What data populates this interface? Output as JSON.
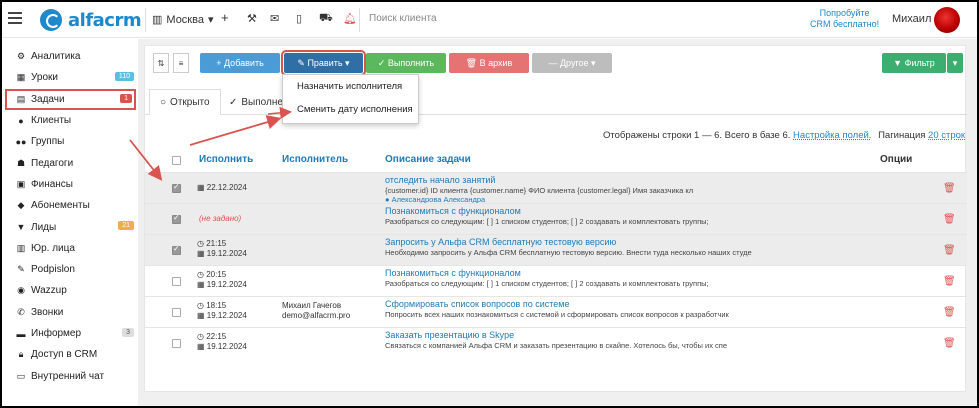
{
  "topbar": {
    "logo_text": "alfacrm",
    "city": "Москва",
    "search_placeholder": "Поиск клиента",
    "promo_line1": "Попробуйте",
    "promo_line2": "CRM бесплатно!",
    "user_name": "Михаил"
  },
  "sidebar": {
    "items": [
      {
        "label": "Аналитика",
        "icon": "chart-icon",
        "glyph": "⚙"
      },
      {
        "label": "Уроки",
        "icon": "calendar-icon",
        "glyph": "▦",
        "badge": "110",
        "badge_color": "#5bc0de"
      },
      {
        "label": "Задачи",
        "icon": "tasks-icon",
        "glyph": "▤",
        "badge": "1",
        "badge_color": "#d9534f",
        "active": true
      },
      {
        "label": "Клиенты",
        "icon": "user-icon",
        "glyph": "●"
      },
      {
        "label": "Группы",
        "icon": "group-icon",
        "glyph": "●●"
      },
      {
        "label": "Педагоги",
        "icon": "teacher-icon",
        "glyph": "☗"
      },
      {
        "label": "Финансы",
        "icon": "money-icon",
        "glyph": "▣"
      },
      {
        "label": "Абонементы",
        "icon": "tag-icon",
        "glyph": "◆"
      },
      {
        "label": "Лиды",
        "icon": "funnel-icon",
        "glyph": "▼",
        "badge": "21",
        "badge_color": "#f0ad4e"
      },
      {
        "label": "Юр. лица",
        "icon": "building-icon",
        "glyph": "▥"
      },
      {
        "label": "Podpislon",
        "icon": "sign-icon",
        "glyph": "✎"
      },
      {
        "label": "Wazzup",
        "icon": "whatsapp-icon",
        "glyph": "◉"
      },
      {
        "label": "Звонки",
        "icon": "phone-icon",
        "glyph": "✆"
      },
      {
        "label": "Информер",
        "icon": "informer-icon",
        "glyph": "▬",
        "badge": "3",
        "badge_color": "#ddd"
      },
      {
        "label": "Доступ в CRM",
        "icon": "lock-icon",
        "glyph": "🔒︎"
      },
      {
        "label": "Внутренний чат",
        "icon": "chat-icon",
        "glyph": "▭"
      }
    ]
  },
  "toolbar": {
    "add": "+ Добавить",
    "edit": "✎ Править ▾",
    "complete": "✓ Выполнить",
    "archive": "🗑︎ В архив",
    "other": "— Другое ▾",
    "filter": "▼ Фильтр"
  },
  "tabs": {
    "open": "Открыто",
    "done": "Выполнено"
  },
  "dropdown": {
    "assign": "Назначить исполнителя",
    "change_date": "Сменить дату исполнения"
  },
  "info": {
    "rows_text": "Отображены строки 1 — 6. Всего в базе 6.",
    "fields_link": "Настройка полей.",
    "pagination_label": "Пагинация",
    "pagination_value": "20 строк"
  },
  "table": {
    "headers": {
      "due": "Исполнить",
      "assignee": "Исполнитель",
      "description": "Описание задачи",
      "options": "Опции"
    },
    "rows": [
      {
        "checked": true,
        "time": "",
        "date": "22.12.2024",
        "assignee": "",
        "assignee_email": "",
        "title": "отследить начало занятий",
        "desc": "{customer.id} ID клиента {customer.name} ФИО клиента {customer.legal} Имя заказчика кл",
        "extra": "Александрова Александра"
      },
      {
        "checked": true,
        "time": "",
        "date": "(не задано)",
        "assignee": "",
        "assignee_email": "",
        "title": "Познакомиться с функционалом",
        "desc": "Разобраться со следующим: [ ] 1 списком студентов; [ ] 2 создавать и комплектовать группы;",
        "extra": ""
      },
      {
        "checked": true,
        "time": "21:15",
        "date": "19.12.2024",
        "assignee": "",
        "assignee_email": "",
        "title": "Запросить у Альфа CRM бесплатную тестовую версию",
        "desc": "Необходимо запросить у Альфа CRM бесплатную тестовую версию. Внести туда несколько наших студе",
        "extra": ""
      },
      {
        "checked": false,
        "time": "20:15",
        "date": "19.12.2024",
        "assignee": "",
        "assignee_email": "",
        "title": "Познакомиться с функционалом",
        "desc": "Разобраться со следующим: [ ] 1 списком студентов; [ ] 2 создавать и комплектовать группы;",
        "extra": ""
      },
      {
        "checked": false,
        "time": "18:15",
        "date": "19.12.2024",
        "assignee": "Михаил Гачегов",
        "assignee_email": "demo@alfacrm.pro",
        "title": "Сформировать список вопросов по системе",
        "desc": "Попросить всех наших познакомиться с системой и сформировать список вопросов к разработчик",
        "extra": ""
      },
      {
        "checked": false,
        "time": "22:15",
        "date": "19.12.2024",
        "assignee": "",
        "assignee_email": "",
        "title": "Заказать презентацию в Skype",
        "desc": "Связаться с компанией Альфа CRM и заказать презентацию в скайпе. Хотелось бы, чтобы их спе",
        "extra": ""
      }
    ]
  },
  "colors": {
    "accent": "#1e88c9",
    "add": "#4a9bd6",
    "edit": "#2f6fa6",
    "complete": "#5cb85c",
    "archive": "#e57373",
    "other": "#bdbdbd",
    "filter": "#3cae6f",
    "annotation": "#d9534f"
  }
}
